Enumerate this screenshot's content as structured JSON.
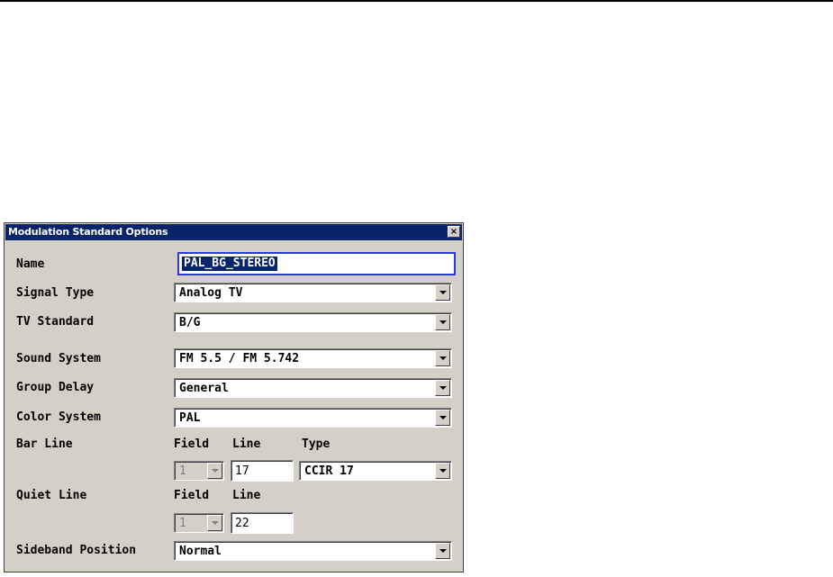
{
  "dialog": {
    "title": "Modulation Standard Options",
    "close_glyph": "×",
    "close_icon": "close-icon"
  },
  "fields": {
    "name": {
      "label": "Name",
      "value": "PAL_BG_STEREO"
    },
    "signal_type": {
      "label": "Signal Type",
      "value": "Analog TV"
    },
    "tv_standard": {
      "label": "TV Standard",
      "value": "B/G"
    },
    "sound_system": {
      "label": "Sound System",
      "value": "FM 5.5 / FM 5.742"
    },
    "group_delay": {
      "label": "Group Delay",
      "value": "General"
    },
    "color_system": {
      "label": "Color System",
      "value": "PAL"
    },
    "bar_line": {
      "label": "Bar Line",
      "field_header": "Field",
      "line_header": "Line",
      "type_header": "Type",
      "field_value": "1",
      "line_value": "17",
      "type_value": "CCIR 17"
    },
    "quiet_line": {
      "label": "Quiet Line",
      "field_header": "Field",
      "line_header": "Line",
      "field_value": "1",
      "line_value": "22"
    },
    "sideband_position": {
      "label": "Sideband Position",
      "value": "Normal"
    }
  },
  "colors": {
    "titlebar": "#0a246a",
    "dialog_bg": "#d4d0c8",
    "focus_border": "#2b3bd6"
  }
}
